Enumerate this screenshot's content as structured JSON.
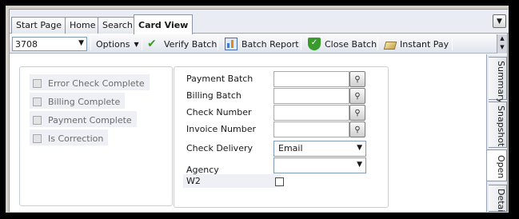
{
  "tabs": [
    {
      "label": "Start Page"
    },
    {
      "label": "Home"
    },
    {
      "label": "Search"
    },
    {
      "label": "Card View",
      "active": true
    }
  ],
  "toolbar": {
    "batch_value": "3708",
    "options_label": "Options",
    "verify_label": "Verify Batch",
    "report_label": "Batch Report",
    "close_label": "Close Batch",
    "instant_label": "Instant Pay"
  },
  "status_checks": [
    {
      "label": "Error Check Complete"
    },
    {
      "label": "Billing Complete"
    },
    {
      "label": "Payment Complete"
    },
    {
      "label": "Is Correction"
    }
  ],
  "form": {
    "payment_batch_label": "Payment Batch",
    "billing_batch_label": "Billing Batch",
    "check_number_label": "Check Number",
    "invoice_number_label": "Invoice Number",
    "check_delivery_label": "Check Delivery",
    "check_delivery_value": "Email",
    "agency_label": "Agency",
    "agency_value": "",
    "w2_label": "W2"
  },
  "side_tabs": [
    {
      "label": "Summary"
    },
    {
      "label": "Snapshot"
    },
    {
      "label": "Open",
      "active": true
    },
    {
      "label": "Detail"
    }
  ]
}
